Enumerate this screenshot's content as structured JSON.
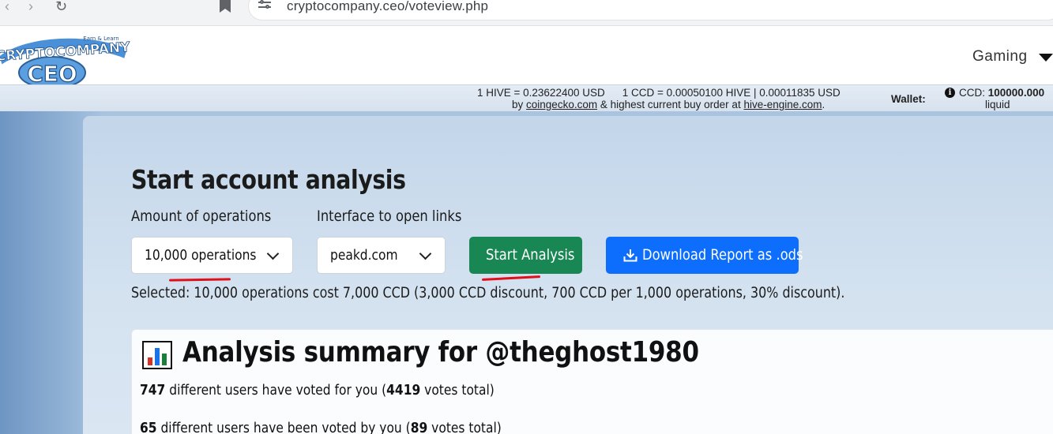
{
  "browser": {
    "url": "cryptocompany.ceo/voteview.php"
  },
  "header": {
    "logo_text_top": "CRYPTOCOMPANY",
    "logo_text_bottom": "CEO",
    "logo_tagline": "Earn & Learn",
    "menu_gaming": "Gaming"
  },
  "rates": {
    "hive_usd": "1 HIVE = 0.23622400 USD",
    "ccd_rate": "1 CCD = 0.00050100 HIVE | 0.00011835 USD",
    "source_prefix": "by",
    "source_link": "coingecko.com",
    "source_middle": "& highest current buy order at",
    "source_link2": "hive-engine.com",
    "source_suffix": ".",
    "wallet_label": "Wallet:",
    "ccd_label": "CCD:",
    "ccd_amount": "100000.000",
    "liquid_label": "liquid"
  },
  "analysis": {
    "heading": "Start account analysis",
    "ops_label": "Amount of operations",
    "ops_value": "10,000 operations",
    "iface_label": "Interface to open links",
    "iface_value": "peakd.com",
    "start_button": "Start Analysis",
    "download_button": "Download Report as .ods",
    "selected_text": "Selected: 10,000 operations cost 7,000 CCD (3,000 CCD discount, 700 CCD per 1,000 operations, 30% discount)."
  },
  "summary": {
    "title": "Analysis summary for @theghost1980",
    "line1_count": "747",
    "line1_text": "different users have voted for you (",
    "line1_votes": "4419",
    "line1_suffix": "votes total)",
    "line2_count": "65",
    "line2_text": "different users have been voted by you (",
    "line2_votes": "89",
    "line2_suffix": "votes total)"
  },
  "colors": {
    "start_button": "#198754",
    "download_button": "#0d6efd",
    "annotation_red": "#e0101a"
  }
}
